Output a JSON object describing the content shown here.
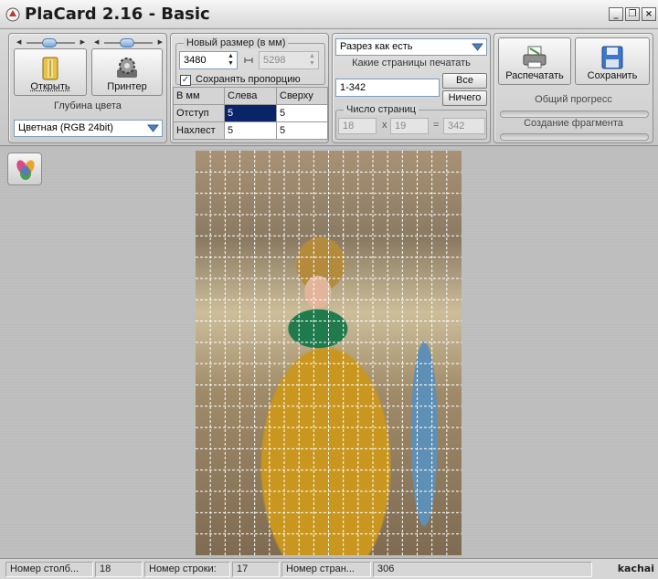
{
  "window": {
    "title": "PlaCard 2.16 - Basic",
    "minimize_glyph": "_",
    "restore_glyph": "❐",
    "close_glyph": "×"
  },
  "toolbar": {
    "open_label": "Открыть",
    "printer_label": "Принтер",
    "color_depth_caption": "Глубина цвета",
    "color_depth_value": "Цветная (RGB 24bit)"
  },
  "size": {
    "group_title": "Новый размер (в мм)",
    "width_value": "3480",
    "height_value": "5298",
    "keep_ratio_label": "Сохранять пропорцию",
    "keep_ratio_checked": true,
    "table": {
      "corner": "В мм",
      "col_left": "Слева",
      "col_top": "Сверху",
      "rows": [
        {
          "label": "Отступ",
          "left": "5",
          "top": "5"
        },
        {
          "label": "Нахлест",
          "left": "5",
          "top": "5"
        }
      ]
    }
  },
  "pages": {
    "cut_mode": "Разрез как есть",
    "which_caption": "Какие страницы печатать",
    "range_value": "1-342",
    "all_button": "Все",
    "none_button": "Ничего",
    "count_title": "Число страниц",
    "cols": "18",
    "rows": "19",
    "total": "342",
    "times_sign": "x",
    "equals_sign": "="
  },
  "actions": {
    "print_label": "Распечатать",
    "save_label": "Сохранить",
    "overall_progress_caption": "Общий прогресс",
    "overall_progress": 0,
    "fragment_caption": "Создание фрагмента",
    "fragment_progress": 0
  },
  "statusbar": {
    "col_label": "Номер столб...",
    "col_value": "18",
    "row_label": "Номер строки:",
    "row_value": "17",
    "page_label": "Номер стран...",
    "page_value": "306",
    "watermark": "kachai"
  },
  "preview": {
    "grid_cols": 18,
    "grid_rows": 19
  },
  "colors": {
    "accent": "#0a246a",
    "field_border": "#7f9db9"
  }
}
